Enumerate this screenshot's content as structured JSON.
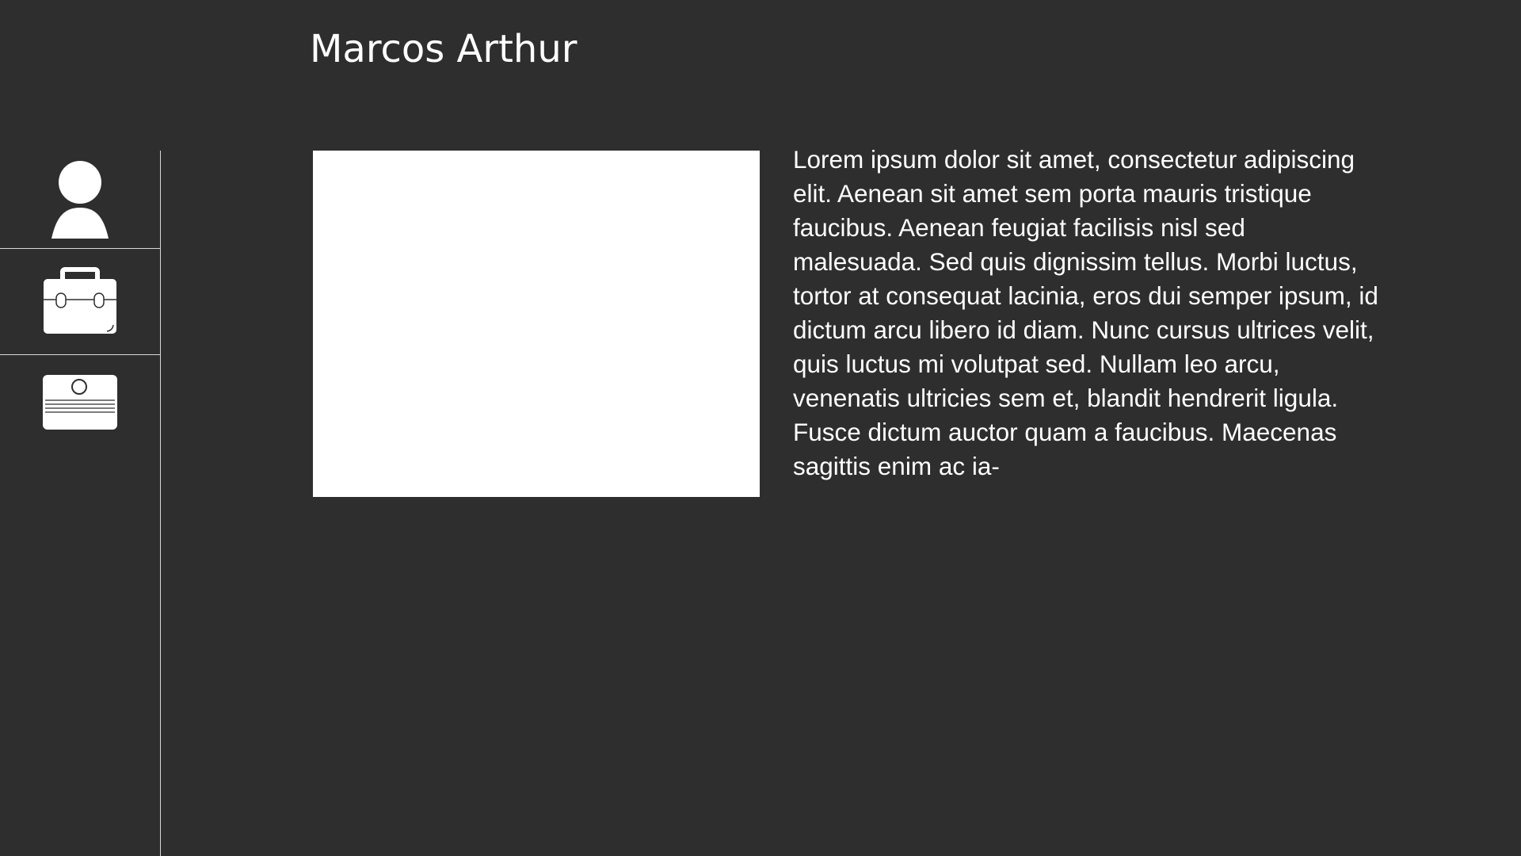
{
  "header": {
    "title": "Marcos Arthur"
  },
  "sidebar": {
    "items": [
      {
        "name": "profile",
        "icon": "user-icon"
      },
      {
        "name": "work",
        "icon": "briefcase-icon"
      },
      {
        "name": "contact",
        "icon": "id-card-icon"
      }
    ]
  },
  "main": {
    "bio": "Lorem ipsum dolor sit amet, consectetur adipiscing elit. Aenean sit amet sem porta mauris tristique faucibus. Aenean feugiat facilisis nisl sed malesuada. Sed quis dignissim tellus. Morbi luctus, tortor at consequat lacinia, eros dui semper ipsum, id dictum arcu libero id diam. Nunc cursus ultrices velit, quis luctus mi volutpat sed. Nullam leo arcu, venenatis ultricies sem et, blandit hendrerit ligula. Fusce dictum auctor quam a faucibus. Maecenas sagittis enim ac ia-"
  },
  "colors": {
    "background": "#2e2e2e",
    "foreground": "#ffffff",
    "divider": "#d8d8d8"
  }
}
